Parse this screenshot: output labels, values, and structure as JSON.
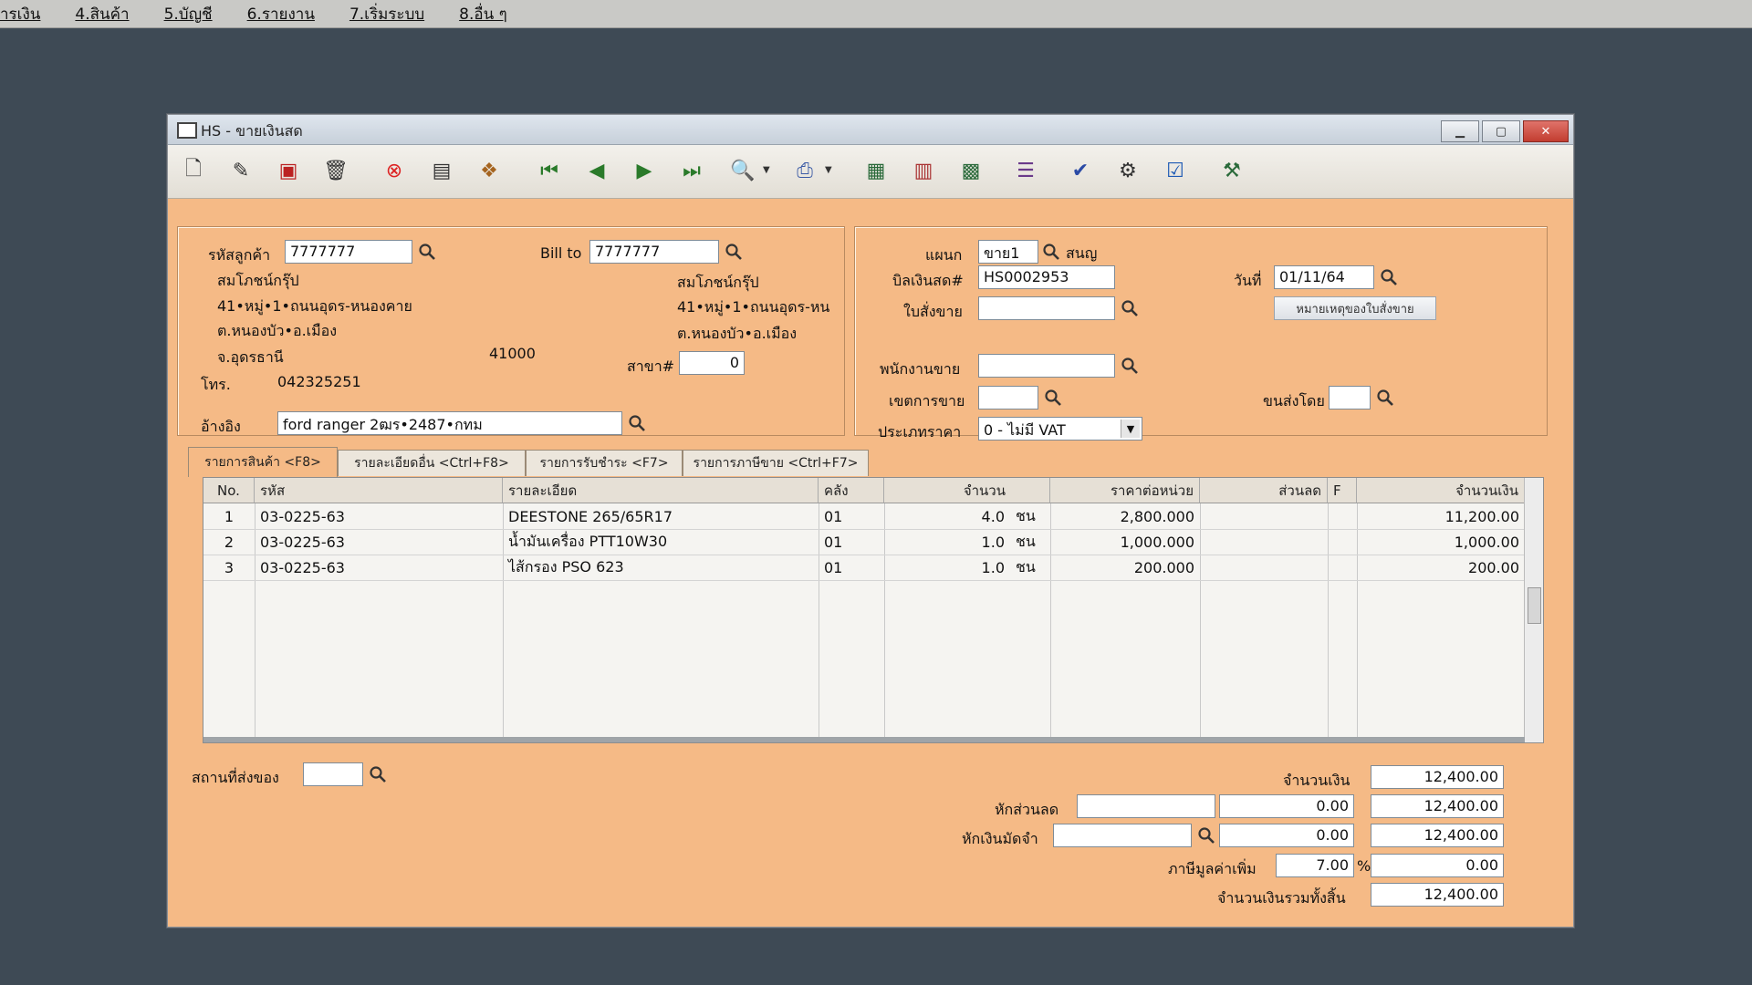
{
  "menu": [
    "ารเงิน",
    "4.สินค้า",
    "5.บัญชี",
    "6.รายงาน",
    "7.เริ่มระบบ",
    "8.อื่น ๆ"
  ],
  "window": {
    "title": "HS - ขายเงินสด"
  },
  "customer": {
    "code_label": "รหัสลูกค้า",
    "code": "7777777",
    "name": "สมโภชน์กรุ๊ป",
    "address1": "41•หมู่•1•ถนนอุดร-หนองคาย",
    "address2": "ต.หนองบัว•อ.เมือง",
    "address3": "จ.อุดรธานี",
    "zip": "41000",
    "phone_label": "โทร.",
    "phone": "042325251",
    "ref_label": "อ้างอิง",
    "ref": "ford ranger 2ฒร•2487•กทม"
  },
  "bill_to": {
    "label": "Bill to",
    "code": "7777777",
    "name": "สมโภชน์กรุ๊ป",
    "address1": "41•หมู่•1•ถนนอุดร-หน",
    "address2": "ต.หนองบัว•อ.เมือง",
    "branch_label": "สาขา#",
    "branch": "0"
  },
  "doc": {
    "dept_label": "แผนก",
    "dept": "ขาย1",
    "dept_name": "สนญ",
    "bill_label": "บิลเงินสด#",
    "bill": "HS0002953",
    "date_label": "วันที่",
    "date": "01/11/64",
    "order_label": "ใบสั่งขาย",
    "order": "",
    "order_note_button": "หมายเหตุของใบสั่งขาย",
    "salesman_label": "พนักงานขาย",
    "salesman": "",
    "area_label": "เขตการขาย",
    "area": "",
    "shipby_label": "ขนส่งโดย",
    "shipby": "",
    "pricetype_label": "ประเภทราคา",
    "pricetype": "0 - ไม่มี VAT"
  },
  "tabs": [
    "รายการสินค้า <F8>",
    "รายละเอียดอื่น <Ctrl+F8>",
    "รายการรับชำระ <F7>",
    "รายการภาษีขาย <Ctrl+F7>"
  ],
  "grid": {
    "headers": [
      "No.",
      "รหัส",
      "รายละเอียด",
      "คลัง",
      "จำนวน",
      "ราคาต่อหน่วย",
      "ส่วนลด",
      "F",
      "จำนวนเงิน"
    ],
    "rows": [
      {
        "no": "1",
        "code": "03-0225-63",
        "desc": "DEESTONE 265/65R17",
        "wh": "01",
        "qty": "4.0",
        "unit": "ชน",
        "price": "2,800.000",
        "disc": "",
        "f": "",
        "amount": "11,200.00"
      },
      {
        "no": "2",
        "code": "03-0225-63",
        "desc": "น้ำมันเครื่อง PTT10W30",
        "wh": "01",
        "qty": "1.0",
        "unit": "ชน",
        "price": "1,000.000",
        "disc": "",
        "f": "",
        "amount": "1,000.00"
      },
      {
        "no": "3",
        "code": "03-0225-63",
        "desc": "ไส้กรอง PSO 623",
        "wh": "01",
        "qty": "1.0",
        "unit": "ชน",
        "price": "200.000",
        "disc": "",
        "f": "",
        "amount": "200.00"
      }
    ]
  },
  "footer": {
    "ship_place_label": "สถานที่ส่งของ",
    "ship_place": "",
    "amount_label": "จำนวนเงิน",
    "amount": "12,400.00",
    "discount_label": "หักส่วนลด",
    "discount_text": "",
    "discount_value": "0.00",
    "after_discount": "12,400.00",
    "deposit_label": "หักเงินมัดจำ",
    "deposit_text": "",
    "deposit_value": "0.00",
    "after_deposit": "12,400.00",
    "vat_label": "ภาษีมูลค่าเพิ่ม",
    "vat_rate": "7.00",
    "vat_percent": "%",
    "vat_amount": "0.00",
    "total_label": "จำนวนเงินรวมทั้งสิ้น",
    "total": "12,400.00"
  },
  "toolbar_icons": [
    "new-doc-icon",
    "edit-icon",
    "void-icon",
    "delete-icon",
    "cancel-icon",
    "save-icon",
    "copy-icon",
    "first-record-icon",
    "prev-record-icon",
    "next-record-icon",
    "last-record-icon",
    "find-icon",
    "print-icon",
    "report-icon",
    "calculator-icon",
    "export-icon",
    "form-icon",
    "approve-icon",
    "settings-icon",
    "ok-icon",
    "tools-icon"
  ]
}
